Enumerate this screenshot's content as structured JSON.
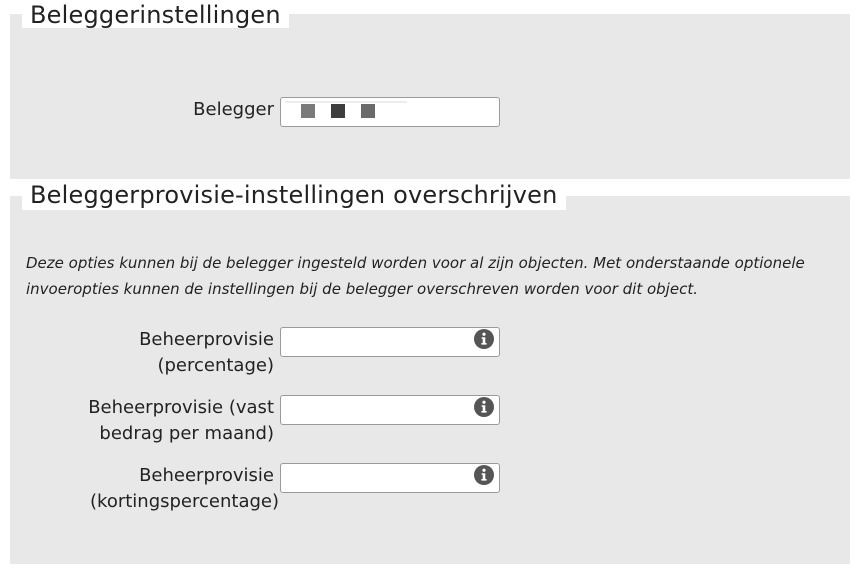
{
  "investor_settings": {
    "title": "Beleggerinstellingen",
    "investor_label": "Belegger",
    "investor_value_masked": [
      "#7a7a7a",
      "#3d3d3d",
      "#6a6a6a"
    ]
  },
  "commission_overrides": {
    "title": "Beleggerprovisie-instellingen overschrijven",
    "description": "Deze opties kunnen bij de belegger ingesteld worden voor al zijn objecten. Met onderstaande optionele invoeropties kunnen de instellingen bij de belegger overschreven worden voor dit object.",
    "fields": [
      {
        "label_line1": "Beheerprovisie",
        "label_line2": "(percentage)",
        "value": "",
        "icon": "info-icon"
      },
      {
        "label_line1": "Beheerprovisie (vast",
        "label_line2": "bedrag per maand)",
        "value": "",
        "icon": "info-icon"
      },
      {
        "label_line1": "Beheerprovisie",
        "label_line2": "(kortingspercentage)",
        "value": "",
        "icon": "info-icon"
      }
    ]
  },
  "colors": {
    "panel_bg": "#e8e8e8",
    "info_icon": "#555555"
  }
}
